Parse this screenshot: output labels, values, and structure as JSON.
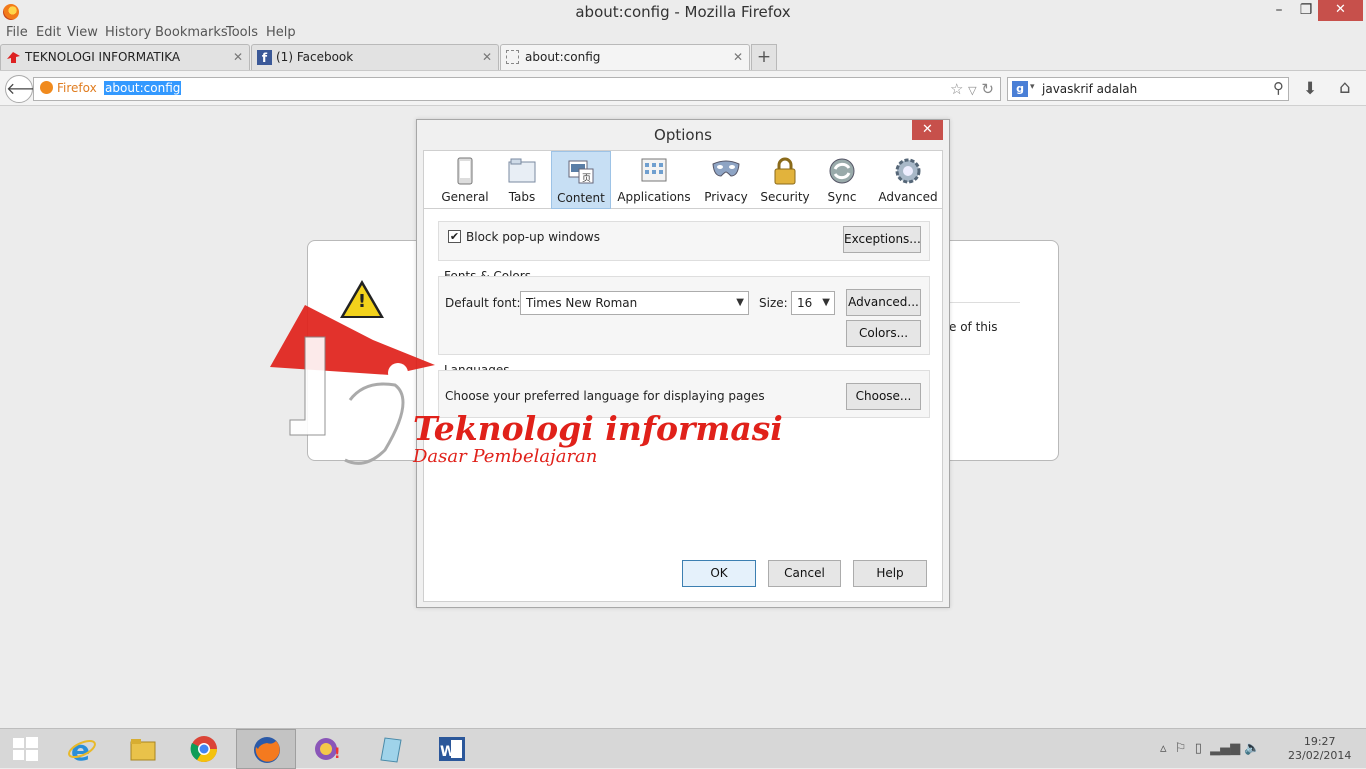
{
  "window": {
    "title": "about:config - Mozilla Firefox",
    "minimize": "–",
    "maximize": "❐",
    "close": "✕"
  },
  "menu": [
    "File",
    "Edit",
    "View",
    "History",
    "Bookmarks",
    "Tools",
    "Help"
  ],
  "tabs": [
    {
      "label": "TEKNOLOGI INFORMATIKA"
    },
    {
      "label": "(1) Facebook"
    },
    {
      "label": "about:config"
    }
  ],
  "new_tab": "+",
  "navbar": {
    "identity": "Firefox",
    "url": "about:config",
    "search_value": "javaskrif adalah",
    "search_engine": "g"
  },
  "page": {
    "error_snippet": "e of this"
  },
  "dialog": {
    "title": "Options",
    "panes": [
      {
        "label": "General",
        "icon": "general-icon"
      },
      {
        "label": "Tabs",
        "icon": "tabs-icon"
      },
      {
        "label": "Content",
        "icon": "content-icon"
      },
      {
        "label": "Applications",
        "icon": "applications-icon"
      },
      {
        "label": "Privacy",
        "icon": "privacy-icon"
      },
      {
        "label": "Security",
        "icon": "security-icon"
      },
      {
        "label": "Sync",
        "icon": "sync-icon"
      },
      {
        "label": "Advanced",
        "icon": "advanced-icon"
      }
    ],
    "selected_pane": "Content",
    "block_popups": {
      "label": "Block pop-up windows",
      "checked": true,
      "exceptions": "Exceptions..."
    },
    "fonts": {
      "heading": "Fonts & Colors",
      "default_font_label": "Default font:",
      "default_font": "Times New Roman",
      "size_label": "Size:",
      "size": "16",
      "advanced": "Advanced...",
      "colors": "Colors..."
    },
    "languages": {
      "heading": "Languages",
      "description": "Choose your preferred language for displaying pages",
      "choose": "Choose..."
    },
    "buttons": {
      "ok": "OK",
      "cancel": "Cancel",
      "help": "Help"
    }
  },
  "watermark": {
    "title": "Teknologi informasi",
    "subtitle": "Dasar Pembelajaran",
    "color": "#e0211a"
  },
  "taskbar": {
    "time": "19:27",
    "date": "23/02/2014"
  },
  "colors": {
    "accent": "#3399ff",
    "close_red": "#c7504b",
    "selected_pane": "#c7dff4"
  }
}
